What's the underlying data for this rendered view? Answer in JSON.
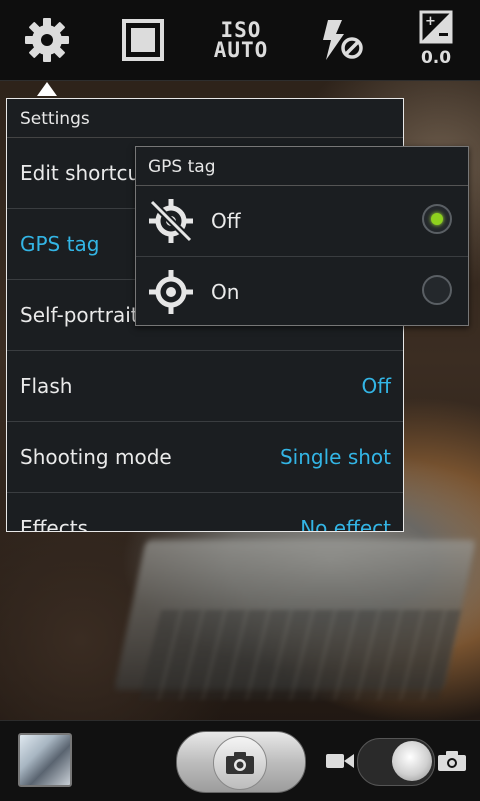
{
  "toolbar": {
    "settings_icon": "gear-icon",
    "frame_icon": "square-frame-icon",
    "iso_line1": "ISO",
    "iso_line2": "AUTO",
    "flash_icon": "flash-off-icon",
    "ev_value": "0.0"
  },
  "settings": {
    "title": "Settings",
    "rows": [
      {
        "label": "Edit shortcuts",
        "value": ""
      },
      {
        "label": "GPS tag",
        "value": ""
      },
      {
        "label": "Self-portrait",
        "value": ""
      },
      {
        "label": "Flash",
        "value": "Off"
      },
      {
        "label": "Shooting mode",
        "value": "Single shot"
      },
      {
        "label": "Effects",
        "value": "No effect"
      }
    ]
  },
  "gps_popup": {
    "title": "GPS tag",
    "options": [
      {
        "label": "Off",
        "icon": "gps-off-icon",
        "selected": true
      },
      {
        "label": "On",
        "icon": "gps-target-icon",
        "selected": false
      }
    ]
  },
  "bottom": {
    "thumbnail": "last-photo-thumbnail",
    "shutter_icon": "camera-icon",
    "video_icon": "video-camera-icon",
    "photo_icon": "camera-icon",
    "mode": "photo"
  },
  "colors": {
    "accent": "#33b5e5",
    "selected_radio": "#8ed11e"
  }
}
